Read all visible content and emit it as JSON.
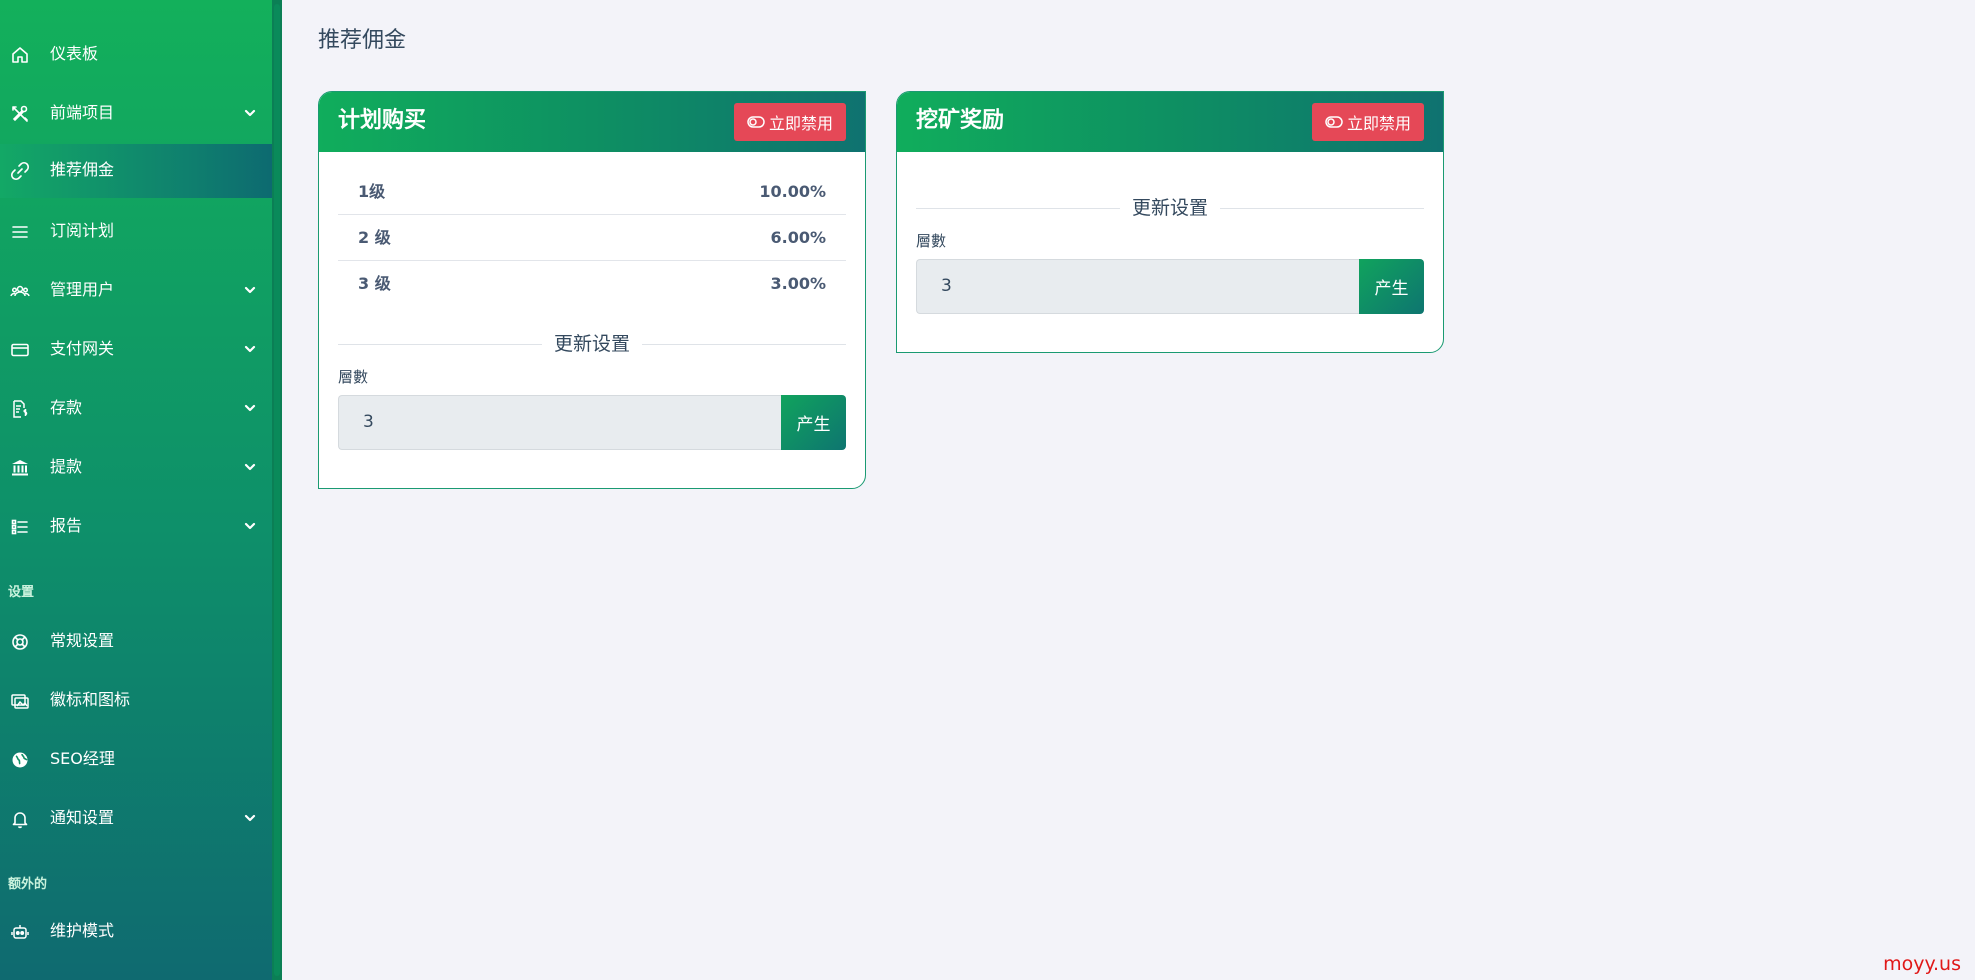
{
  "page": {
    "title": "推荐佣金"
  },
  "sidebar": {
    "items": [
      {
        "label": "仪表板",
        "icon": "home-icon"
      },
      {
        "label": "前端项目",
        "icon": "tools-icon",
        "has_children": true
      },
      {
        "label": "推荐佣金",
        "icon": "link-icon",
        "active": true
      },
      {
        "label": "订阅计划",
        "icon": "list-icon"
      },
      {
        "label": "管理用户",
        "icon": "users-icon",
        "has_children": true
      },
      {
        "label": "支付网关",
        "icon": "card-icon",
        "has_children": true
      },
      {
        "label": "存款",
        "icon": "deposit-icon",
        "has_children": true
      },
      {
        "label": "提款",
        "icon": "bank-icon",
        "has_children": true
      },
      {
        "label": "报告",
        "icon": "report-icon",
        "has_children": true
      }
    ],
    "settings_section": "设置",
    "settings_items": [
      {
        "label": "常规设置",
        "icon": "settings-icon"
      },
      {
        "label": "徽标和图标",
        "icon": "images-icon"
      },
      {
        "label": "SEO经理",
        "icon": "globe-icon"
      },
      {
        "label": "通知设置",
        "icon": "bell-icon",
        "has_children": true
      }
    ],
    "extra_section": "额外的",
    "extra_items": [
      {
        "label": "维护模式",
        "icon": "robot-icon"
      }
    ]
  },
  "cards": {
    "plan_purchase": {
      "title": "计划购买",
      "disable_label": "立即禁用",
      "levels": [
        {
          "name": "1级",
          "value": "10.00%"
        },
        {
          "name": "2 级",
          "value": "6.00%"
        },
        {
          "name": "3 级",
          "value": "3.00%"
        }
      ],
      "update_heading": "更新设置",
      "field_label": "層數",
      "field_value": "3",
      "generate_label": "产生"
    },
    "mining_reward": {
      "title": "挖矿奖励",
      "disable_label": "立即禁用",
      "update_heading": "更新设置",
      "field_label": "層數",
      "field_value": "3",
      "generate_label": "产生"
    }
  },
  "watermark": "moyy.us",
  "colors": {
    "primary_green": "#13b05b",
    "teal": "#0f6a70",
    "danger": "#e54857",
    "background": "#f3f3f9"
  }
}
